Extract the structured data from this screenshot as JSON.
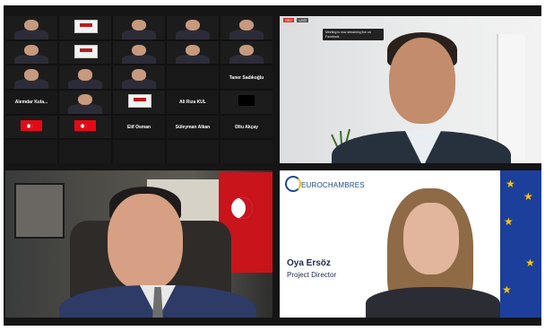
{
  "gallery": {
    "tiles": [
      {
        "kind": "photo",
        "name": "",
        "label": ""
      },
      {
        "kind": "logo",
        "name": "",
        "label": ""
      },
      {
        "kind": "photo",
        "name": "",
        "label": ""
      },
      {
        "kind": "photo",
        "name": "",
        "label": ""
      },
      {
        "kind": "photo",
        "name": "",
        "label": ""
      },
      {
        "kind": "photo",
        "name": "",
        "label": ""
      },
      {
        "kind": "logo",
        "name": "",
        "label": ""
      },
      {
        "kind": "photo",
        "name": "",
        "label": ""
      },
      {
        "kind": "photo",
        "name": "",
        "label": ""
      },
      {
        "kind": "photo",
        "name": "",
        "label": ""
      },
      {
        "kind": "photo",
        "name": "",
        "label": ""
      },
      {
        "kind": "photo",
        "name": "",
        "label": ""
      },
      {
        "kind": "photo",
        "name": "",
        "label": ""
      },
      {
        "kind": "dark",
        "name": "",
        "label": ""
      },
      {
        "kind": "dark",
        "name": "",
        "label": "Taner Sadıkoğlu"
      },
      {
        "kind": "dark",
        "name": "",
        "label": "Alemdar Kula..."
      },
      {
        "kind": "photo",
        "name": "",
        "label": ""
      },
      {
        "kind": "logo",
        "name": "",
        "label": ""
      },
      {
        "kind": "dark",
        "name": "",
        "label": "Ali Rıza KUL"
      },
      {
        "kind": "black",
        "name": "",
        "label": ""
      },
      {
        "kind": "flag",
        "name": "",
        "label": ""
      },
      {
        "kind": "flag",
        "name": "",
        "label": ""
      },
      {
        "kind": "dark",
        "name": "",
        "label": "Elif Osman"
      },
      {
        "kind": "dark",
        "name": "",
        "label": "Süleyman Alkan"
      },
      {
        "kind": "dark",
        "name": "",
        "label": "Oltu Akçay"
      },
      {
        "kind": "dark",
        "name": "",
        "label": ""
      },
      {
        "kind": "dark",
        "name": "",
        "label": ""
      },
      {
        "kind": "dark",
        "name": "",
        "label": ""
      },
      {
        "kind": "dark",
        "name": "",
        "label": ""
      },
      {
        "kind": "dark",
        "name": "",
        "label": ""
      }
    ]
  },
  "top_right": {
    "tooltip": "Meeting is now streaming live on Facebook",
    "rec_label": "REC",
    "live_label": "LIVE"
  },
  "bottom_right": {
    "brand": "EUROCHAMBRES",
    "person_name": "Oya Ersöz",
    "person_role": "Project Director"
  },
  "colors": {
    "frame": "#151515",
    "eu_blue": "#1d3f9c",
    "eu_gold": "#f5c400",
    "brand_blue": "#1e4a8f"
  }
}
